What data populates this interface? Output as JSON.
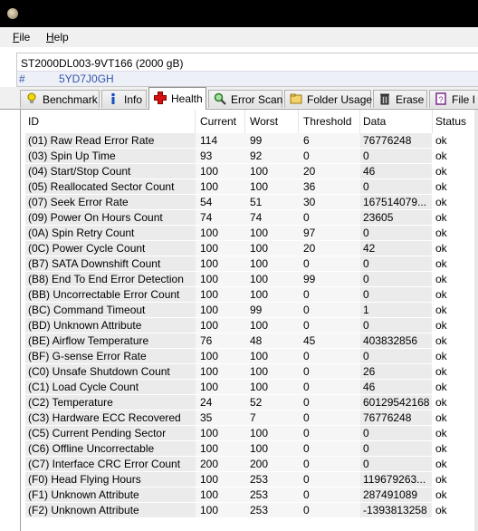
{
  "menu": {
    "file": "File",
    "file_key": "F",
    "file_rest": "ile",
    "help": "Help",
    "help_key": "H",
    "help_rest": "elp"
  },
  "drive": {
    "name": "ST2000DL003-9VT166 (2000 gB)",
    "hash": "#",
    "serial": "5YD7J0GH"
  },
  "tabs": [
    {
      "label": "Benchmark",
      "icon": "bulb-icon"
    },
    {
      "label": "Info",
      "icon": "info-icon"
    },
    {
      "label": "Health",
      "icon": "health-cross-icon",
      "active": true
    },
    {
      "label": "Error Scan",
      "icon": "magnifier-icon"
    },
    {
      "label": "Folder Usage",
      "icon": "folder-icon"
    },
    {
      "label": "Erase",
      "icon": "trash-icon"
    },
    {
      "label": "File I",
      "icon": "file-info-icon"
    }
  ],
  "columns": [
    "ID",
    "Current",
    "Worst",
    "Threshold",
    "Data",
    "Status"
  ],
  "rows": [
    [
      "(01) Raw Read Error Rate",
      "114",
      "99",
      "6",
      "76776248",
      "ok"
    ],
    [
      "(03) Spin Up Time",
      "93",
      "92",
      "0",
      "0",
      "ok"
    ],
    [
      "(04) Start/Stop Count",
      "100",
      "100",
      "20",
      "46",
      "ok"
    ],
    [
      "(05) Reallocated Sector Count",
      "100",
      "100",
      "36",
      "0",
      "ok"
    ],
    [
      "(07) Seek Error Rate",
      "54",
      "51",
      "30",
      "167514079...",
      "ok"
    ],
    [
      "(09) Power On Hours Count",
      "74",
      "74",
      "0",
      "23605",
      "ok"
    ],
    [
      "(0A) Spin Retry Count",
      "100",
      "100",
      "97",
      "0",
      "ok"
    ],
    [
      "(0C) Power Cycle Count",
      "100",
      "100",
      "20",
      "42",
      "ok"
    ],
    [
      "(B7) SATA Downshift Count",
      "100",
      "100",
      "0",
      "0",
      "ok"
    ],
    [
      "(B8) End To End Error Detection",
      "100",
      "100",
      "99",
      "0",
      "ok"
    ],
    [
      "(BB) Uncorrectable Error Count",
      "100",
      "100",
      "0",
      "0",
      "ok"
    ],
    [
      "(BC) Command Timeout",
      "100",
      "99",
      "0",
      "1",
      "ok"
    ],
    [
      "(BD) Unknown Attribute",
      "100",
      "100",
      "0",
      "0",
      "ok"
    ],
    [
      "(BE) Airflow Temperature",
      "76",
      "48",
      "45",
      "403832856",
      "ok"
    ],
    [
      "(BF) G-sense Error Rate",
      "100",
      "100",
      "0",
      "0",
      "ok"
    ],
    [
      "(C0) Unsafe Shutdown Count",
      "100",
      "100",
      "0",
      "26",
      "ok"
    ],
    [
      "(C1) Load Cycle Count",
      "100",
      "100",
      "0",
      "46",
      "ok"
    ],
    [
      "(C2) Temperature",
      "24",
      "52",
      "0",
      "60129542168",
      "ok"
    ],
    [
      "(C3) Hardware ECC Recovered",
      "35",
      "7",
      "0",
      "76776248",
      "ok"
    ],
    [
      "(C5) Current Pending Sector",
      "100",
      "100",
      "0",
      "0",
      "ok"
    ],
    [
      "(C6) Offline Uncorrectable",
      "100",
      "100",
      "0",
      "0",
      "ok"
    ],
    [
      "(C7) Interface CRC Error Count",
      "200",
      "200",
      "0",
      "0",
      "ok"
    ],
    [
      "(F0) Head Flying Hours",
      "100",
      "253",
      "0",
      "119679263...",
      "ok"
    ],
    [
      "(F1) Unknown Attribute",
      "100",
      "253",
      "0",
      "287491089",
      "ok"
    ],
    [
      "(F2) Unknown Attribute",
      "100",
      "253",
      "0",
      "-1393813258",
      "ok"
    ]
  ]
}
